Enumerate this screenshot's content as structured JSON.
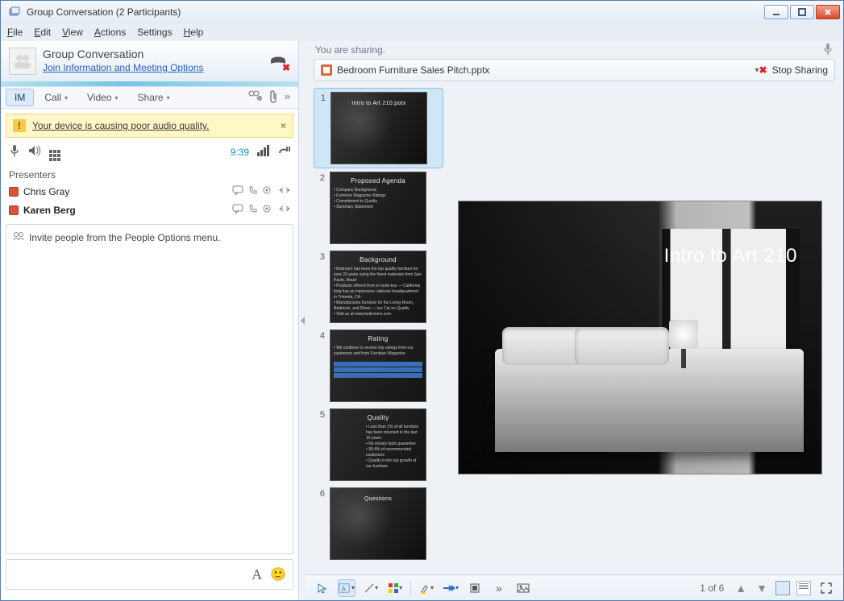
{
  "window": {
    "title": "Group Conversation (2 Participants)"
  },
  "menubar": {
    "file": "File",
    "edit": "Edit",
    "view": "View",
    "actions": "Actions",
    "settings": "Settings",
    "help": "Help"
  },
  "conv": {
    "title": "Group Conversation",
    "link": "Join Information and Meeting Options"
  },
  "tabs": {
    "im": "IM",
    "call": "Call",
    "video": "Video",
    "share": "Share"
  },
  "warning": {
    "text": "Your device is causing poor audio quality.",
    "close": "×"
  },
  "audio": {
    "time": "9:39"
  },
  "presenters_label": "Presenters",
  "participants": [
    {
      "name": "Chris Gray",
      "bold": false
    },
    {
      "name": "Karen Berg",
      "bold": true
    }
  ],
  "chat": {
    "hint": "Invite people from the People Options menu."
  },
  "share": {
    "status": "You are sharing.",
    "file": "Bedroom Furniture Sales Pitch.pptx",
    "stop": "Stop Sharing"
  },
  "slides": {
    "titles": [
      "Intro to Art 210.potx",
      "Proposed Agenda",
      "Background",
      "Rating",
      "Quality",
      "Questions"
    ],
    "main_title": "Intro to Art 210",
    "agenda_lines": [
      "Company Background",
      "Furniture Magazine Ratings",
      "Commitment to Quality",
      "Summary Statement"
    ],
    "counter": "1 of 6"
  }
}
